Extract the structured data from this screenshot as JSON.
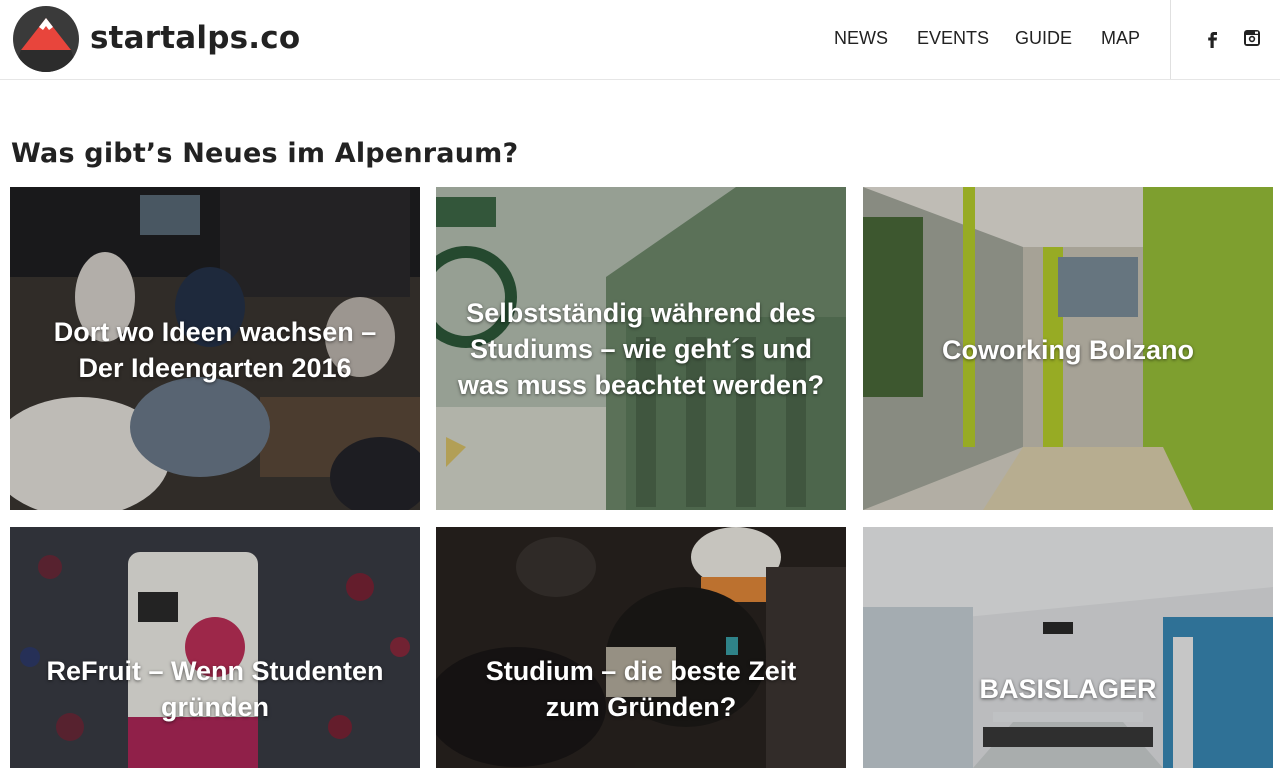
{
  "header": {
    "logo_text": "startalps.co",
    "nav": [
      {
        "label": "NEWS"
      },
      {
        "label": "EVENTS"
      },
      {
        "label": "GUIDE"
      },
      {
        "label": "MAP"
      }
    ],
    "social": [
      {
        "icon": "facebook-icon"
      },
      {
        "icon": "instagram-icon"
      }
    ]
  },
  "main": {
    "section_title": "Was gibt’s Neues im Alpenraum?",
    "tiles": [
      {
        "title_lines": [
          "Dort wo Ideen wachsen –",
          "Der Ideengarten 2016"
        ]
      },
      {
        "title_lines": [
          "Selbstständig während des",
          "Studiums – wie geht´s und",
          "was muss beachtet werden?"
        ]
      },
      {
        "title_lines": [
          "Coworking Bolzano"
        ]
      },
      {
        "title_lines": [
          "ReFruit – Wenn Studenten",
          "gründen"
        ]
      },
      {
        "title_lines": [
          "Studium – die beste Zeit",
          "zum Gründen?"
        ]
      },
      {
        "title_lines": [
          "BASISLAGER"
        ]
      }
    ]
  },
  "colors": {
    "logo_red": "#e8453c",
    "text": "#222222",
    "divider": "#e0e0e0"
  }
}
